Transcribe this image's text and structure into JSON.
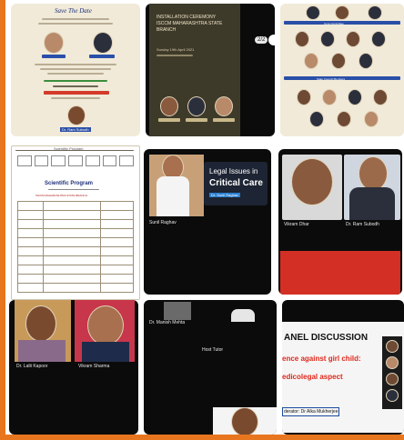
{
  "tiles": {
    "invitation": {
      "title": "Save The Date",
      "footer": "Dr. Ram Subodh"
    },
    "ceremony": {
      "title": "INSTALLATION CEREMONY\nISCCM MAHARASHTRA STATE\nBRANCH",
      "date_line": "Sunday 19th April 2021",
      "nav_badge": "2/2"
    },
    "roster": {
      "section_a": "Core Committee",
      "section_b": "State Council Members"
    },
    "scientific": {
      "title": "Scientific Program",
      "subtitle": "ISCCM MAHARASHTRA STATE BRANCH",
      "top_banner": "Scientific Program"
    },
    "video_legal": {
      "slide_line1": "Legal Issues in",
      "slide_line2": "Critical Care",
      "speaker_tag": "Dr. Sunil Raghav",
      "name_tag": "Sunil Raghav"
    },
    "video_two": {
      "left_tag": "Vikram Dhar",
      "right_tag": "Dr. Ram Subodh"
    },
    "video_bottom_left": {
      "left_tag": "Dr. Lalit Kapoor",
      "right_tag": "Vikram Sharma"
    },
    "video_blank": {
      "top_tag": "Dr. Manish Mehta",
      "center_tag": "Host Tutor"
    },
    "panel": {
      "heading": "ANEL DISCUSSION",
      "line1": "ence against girl child:",
      "line2": "edicolegal aspect",
      "moderator": "derator: Dr Alka Mukherjee"
    }
  },
  "colors": {
    "accent": "#e8761f",
    "tile_dark": "#0b0b0b",
    "paper": "#f1ead8",
    "slide_red": "#e0281b",
    "slide_blue": "#2a7fd0"
  }
}
